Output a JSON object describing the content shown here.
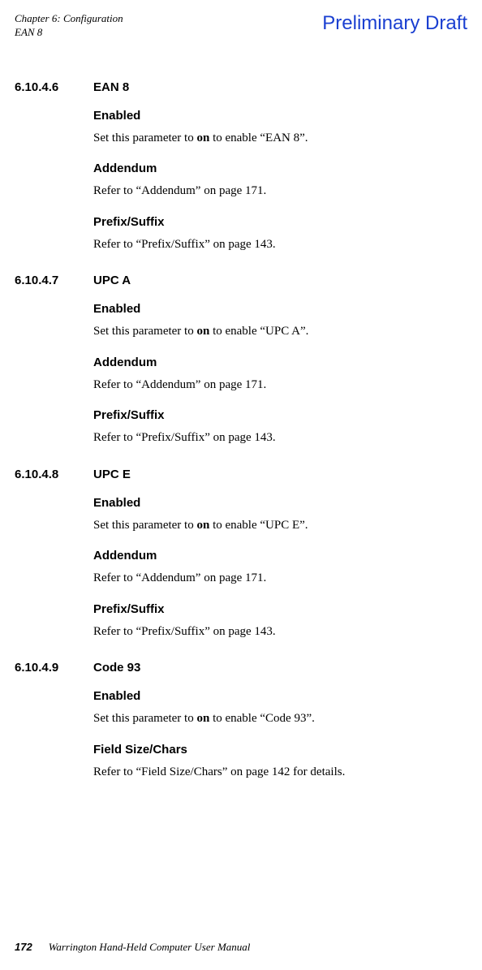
{
  "header": {
    "chapter": "Chapter 6: Configuration",
    "topic": "EAN 8",
    "watermark": "Preliminary Draft"
  },
  "sections": [
    {
      "number": "6.10.4.6",
      "title": "EAN 8",
      "subs": [
        {
          "heading": "Enabled",
          "pre": "Set this parameter to ",
          "bold": "on",
          "post": " to enable “EAN 8”."
        },
        {
          "heading": "Addendum",
          "pre": "Refer to “Addendum” on page 171.",
          "bold": "",
          "post": ""
        },
        {
          "heading": "Prefix/Suffix",
          "pre": "Refer to “Prefix/Suffix” on page 143.",
          "bold": "",
          "post": ""
        }
      ]
    },
    {
      "number": "6.10.4.7",
      "title": "UPC A",
      "subs": [
        {
          "heading": "Enabled",
          "pre": "Set this parameter to ",
          "bold": "on",
          "post": " to enable “UPC A”."
        },
        {
          "heading": "Addendum",
          "pre": "Refer to “Addendum” on page 171.",
          "bold": "",
          "post": ""
        },
        {
          "heading": "Prefix/Suffix",
          "pre": "Refer to “Prefix/Suffix” on page 143.",
          "bold": "",
          "post": ""
        }
      ]
    },
    {
      "number": "6.10.4.8",
      "title": "UPC E",
      "subs": [
        {
          "heading": "Enabled",
          "pre": "Set this parameter to ",
          "bold": "on",
          "post": " to enable “UPC E”."
        },
        {
          "heading": "Addendum",
          "pre": "Refer to “Addendum” on page 171.",
          "bold": "",
          "post": ""
        },
        {
          "heading": "Prefix/Suffix",
          "pre": "Refer to “Prefix/Suffix” on page 143.",
          "bold": "",
          "post": ""
        }
      ]
    },
    {
      "number": "6.10.4.9",
      "title": "Code 93",
      "subs": [
        {
          "heading": "Enabled",
          "pre": "Set this parameter to ",
          "bold": "on",
          "post": " to enable “Code 93”."
        },
        {
          "heading": "Field Size/Chars",
          "pre": "Refer to “Field Size/Chars” on page 142 for details.",
          "bold": "",
          "post": ""
        }
      ]
    }
  ],
  "footer": {
    "page": "172",
    "text": "Warrington Hand-Held Computer User Manual"
  }
}
